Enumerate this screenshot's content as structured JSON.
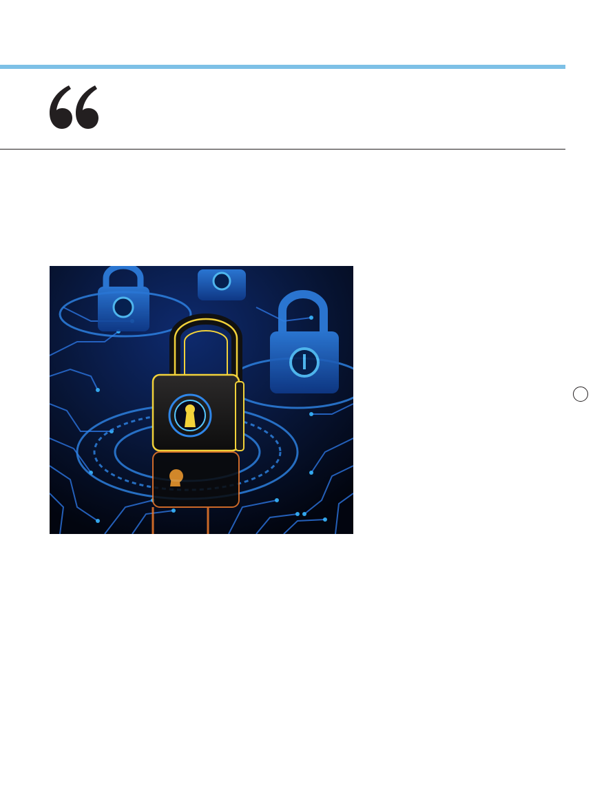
{
  "decor": {
    "rule_color": "#7dc0e6",
    "quote_color": "#231f20",
    "quote_icon": "opening-quotation-mark-icon"
  },
  "photo": {
    "subject": "padlock-on-circuit-board-illustration",
    "colors": {
      "background": "#040818",
      "circuit": "#2a6fd6",
      "glow": "#38b6ff",
      "lock_outline": "#f2d23a",
      "reflection": "#f07a2a"
    }
  },
  "page_marker": {
    "icon": "circle-outline-icon"
  }
}
